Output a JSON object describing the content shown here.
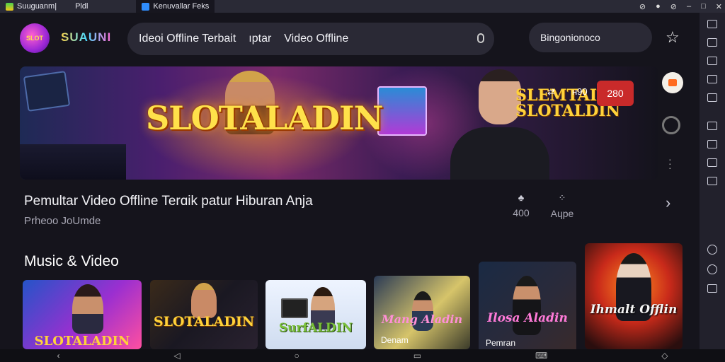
{
  "titlebar": {
    "tabs": [
      {
        "label": "Suuguanm|",
        "active": false
      },
      {
        "label": "Pldl",
        "active": false
      },
      {
        "label": "Kenuvallar Feks",
        "active": true
      }
    ]
  },
  "header": {
    "logo_text": "SLOT",
    "brand": "SUAUNI",
    "search": {
      "items": [
        "Ideoi Offline Terbait",
        "ıptar",
        "Video Offline"
      ]
    },
    "language": "Bingonionoco"
  },
  "banner": {
    "title": "SLOTALADIN",
    "subtitle_line1": "SLEMTAI ▶",
    "subtitle_line2": "SLOTALDIN",
    "ctrl1": "⇄",
    "ctrl2": "ʜ90",
    "badge": "280"
  },
  "video": {
    "title": "Pemultar Video Offline Terɑik patur Hiburan Anja",
    "meta": "Prheoo JoUmde",
    "stats": [
      {
        "icon": "♣",
        "value": "400"
      },
      {
        "icon": "⁘",
        "value": "Aɥpe"
      }
    ]
  },
  "section": {
    "title": "Music & Video"
  },
  "cards": [
    {
      "label": "SLOTALADIN",
      "caption": ""
    },
    {
      "label": "SLOTALADIN",
      "caption": ""
    },
    {
      "label": "SurfALDIN",
      "caption": ""
    },
    {
      "label": "Mang Aladin",
      "caption": "Denam"
    },
    {
      "label": "Ilosa Aladin",
      "caption": "Pemran"
    },
    {
      "label": "Ihmalt Offlin",
      "caption": ""
    }
  ],
  "colors": {
    "background": "#15141c",
    "accent": "#c92a2a",
    "gold": "#ffe14a"
  }
}
